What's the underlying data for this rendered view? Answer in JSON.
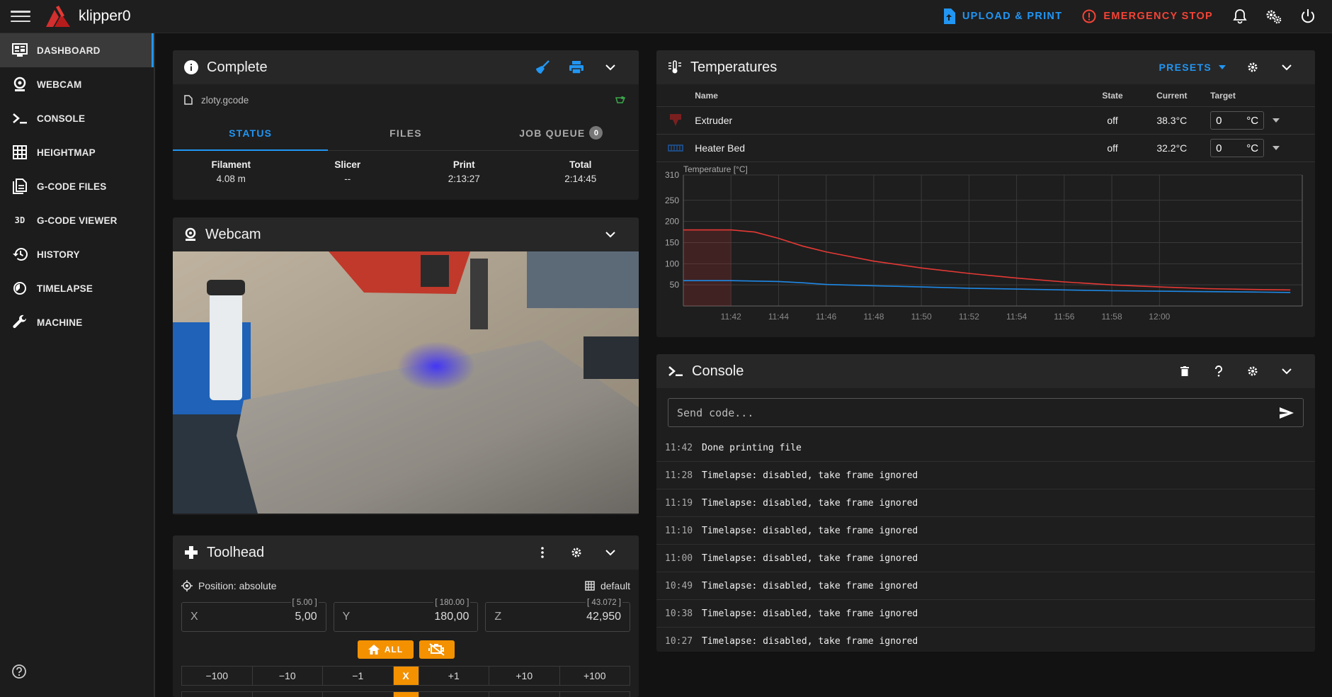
{
  "app": {
    "title": "klipper0",
    "upload_label": "UPLOAD & PRINT",
    "estop_label": "EMERGENCY STOP"
  },
  "sidebar": {
    "items": [
      {
        "label": "DASHBOARD",
        "icon": "monitor-dashboard-icon"
      },
      {
        "label": "WEBCAM",
        "icon": "webcam-icon"
      },
      {
        "label": "CONSOLE",
        "icon": "console-icon"
      },
      {
        "label": "HEIGHTMAP",
        "icon": "grid-icon"
      },
      {
        "label": "G-CODE FILES",
        "icon": "file-document-icon"
      },
      {
        "label": "G-CODE VIEWER",
        "icon": "3d-icon"
      },
      {
        "label": "HISTORY",
        "icon": "history-icon"
      },
      {
        "label": "TIMELAPSE",
        "icon": "timelapse-icon"
      },
      {
        "label": "MACHINE",
        "icon": "wrench-icon"
      }
    ],
    "icon_3d_text": "3D"
  },
  "status": {
    "title": "Complete",
    "filename": "zloty.gcode",
    "tabs": {
      "status": "STATUS",
      "files": "FILES",
      "job_queue": "JOB QUEUE",
      "queue_count": "0"
    },
    "stats": [
      {
        "label": "Filament",
        "value": "4.08 m"
      },
      {
        "label": "Slicer",
        "value": "--"
      },
      {
        "label": "Print",
        "value": "2:13:27"
      },
      {
        "label": "Total",
        "value": "2:14:45"
      }
    ]
  },
  "webcam": {
    "title": "Webcam"
  },
  "toolhead": {
    "title": "Toolhead",
    "position_label": "Position: absolute",
    "profile_label": "default",
    "axes": [
      {
        "name": "X",
        "value": "5,00",
        "max": "[ 5.00 ]"
      },
      {
        "name": "Y",
        "value": "180,00",
        "max": "[ 180.00 ]"
      },
      {
        "name": "Z",
        "value": "42,950",
        "max": "[ 43.072 ]"
      }
    ],
    "home_all_label": "ALL",
    "jog_minus": [
      "−100",
      "−10",
      "−1"
    ],
    "jog_axis": "X",
    "jog_plus": [
      "+1",
      "+10",
      "+100"
    ]
  },
  "temperatures": {
    "title": "Temperatures",
    "presets_label": "PRESETS",
    "columns": {
      "name": "Name",
      "state": "State",
      "current": "Current",
      "target": "Target"
    },
    "rows": [
      {
        "name": "Extruder",
        "state": "off",
        "current": "38.3°C",
        "target": "0",
        "unit": "°C",
        "color": "#e53935"
      },
      {
        "name": "Heater Bed",
        "state": "off",
        "current": "32.2°C",
        "target": "0",
        "unit": "°C",
        "color": "#1e88e5"
      }
    ]
  },
  "chart_data": {
    "type": "line",
    "title": "",
    "ylabel": "Temperature [°C]",
    "xlabel": "",
    "ylim": [
      0,
      310
    ],
    "yticks": [
      50,
      100,
      150,
      200,
      250,
      310
    ],
    "x_ticks": [
      "11:42",
      "11:44",
      "11:46",
      "11:48",
      "11:50",
      "11:52",
      "11:54",
      "11:56",
      "11:58",
      "12:00"
    ],
    "x_minutes": [
      -2,
      0,
      1,
      2,
      3,
      4,
      6,
      8,
      10,
      12,
      14,
      16,
      18,
      20,
      22,
      23.5
    ],
    "series": [
      {
        "name": "Extruder",
        "color": "#e53935",
        "values": [
          180,
          180,
          175,
          160,
          142,
          128,
          106,
          90,
          77,
          66,
          57,
          50,
          45,
          41,
          39,
          38
        ]
      },
      {
        "name": "Heater Bed",
        "color": "#1e88e5",
        "values": [
          60,
          60,
          59,
          58,
          55,
          51,
          48,
          45,
          42,
          40,
          38,
          36,
          35,
          34,
          33,
          32
        ]
      }
    ],
    "grid": true
  },
  "console": {
    "title": "Console",
    "placeholder": "Send code...",
    "lines": [
      {
        "time": "11:42",
        "msg": "Done printing file"
      },
      {
        "time": "11:28",
        "msg": "Timelapse: disabled, take frame ignored"
      },
      {
        "time": "11:19",
        "msg": "Timelapse: disabled, take frame ignored"
      },
      {
        "time": "11:10",
        "msg": "Timelapse: disabled, take frame ignored"
      },
      {
        "time": "11:00",
        "msg": "Timelapse: disabled, take frame ignored"
      },
      {
        "time": "10:49",
        "msg": "Timelapse: disabled, take frame ignored"
      },
      {
        "time": "10:38",
        "msg": "Timelapse: disabled, take frame ignored"
      },
      {
        "time": "10:27",
        "msg": "Timelapse: disabled, take frame ignored"
      }
    ]
  },
  "colors": {
    "accent": "#2196f3",
    "danger": "#f44336",
    "warning": "#f39100"
  }
}
